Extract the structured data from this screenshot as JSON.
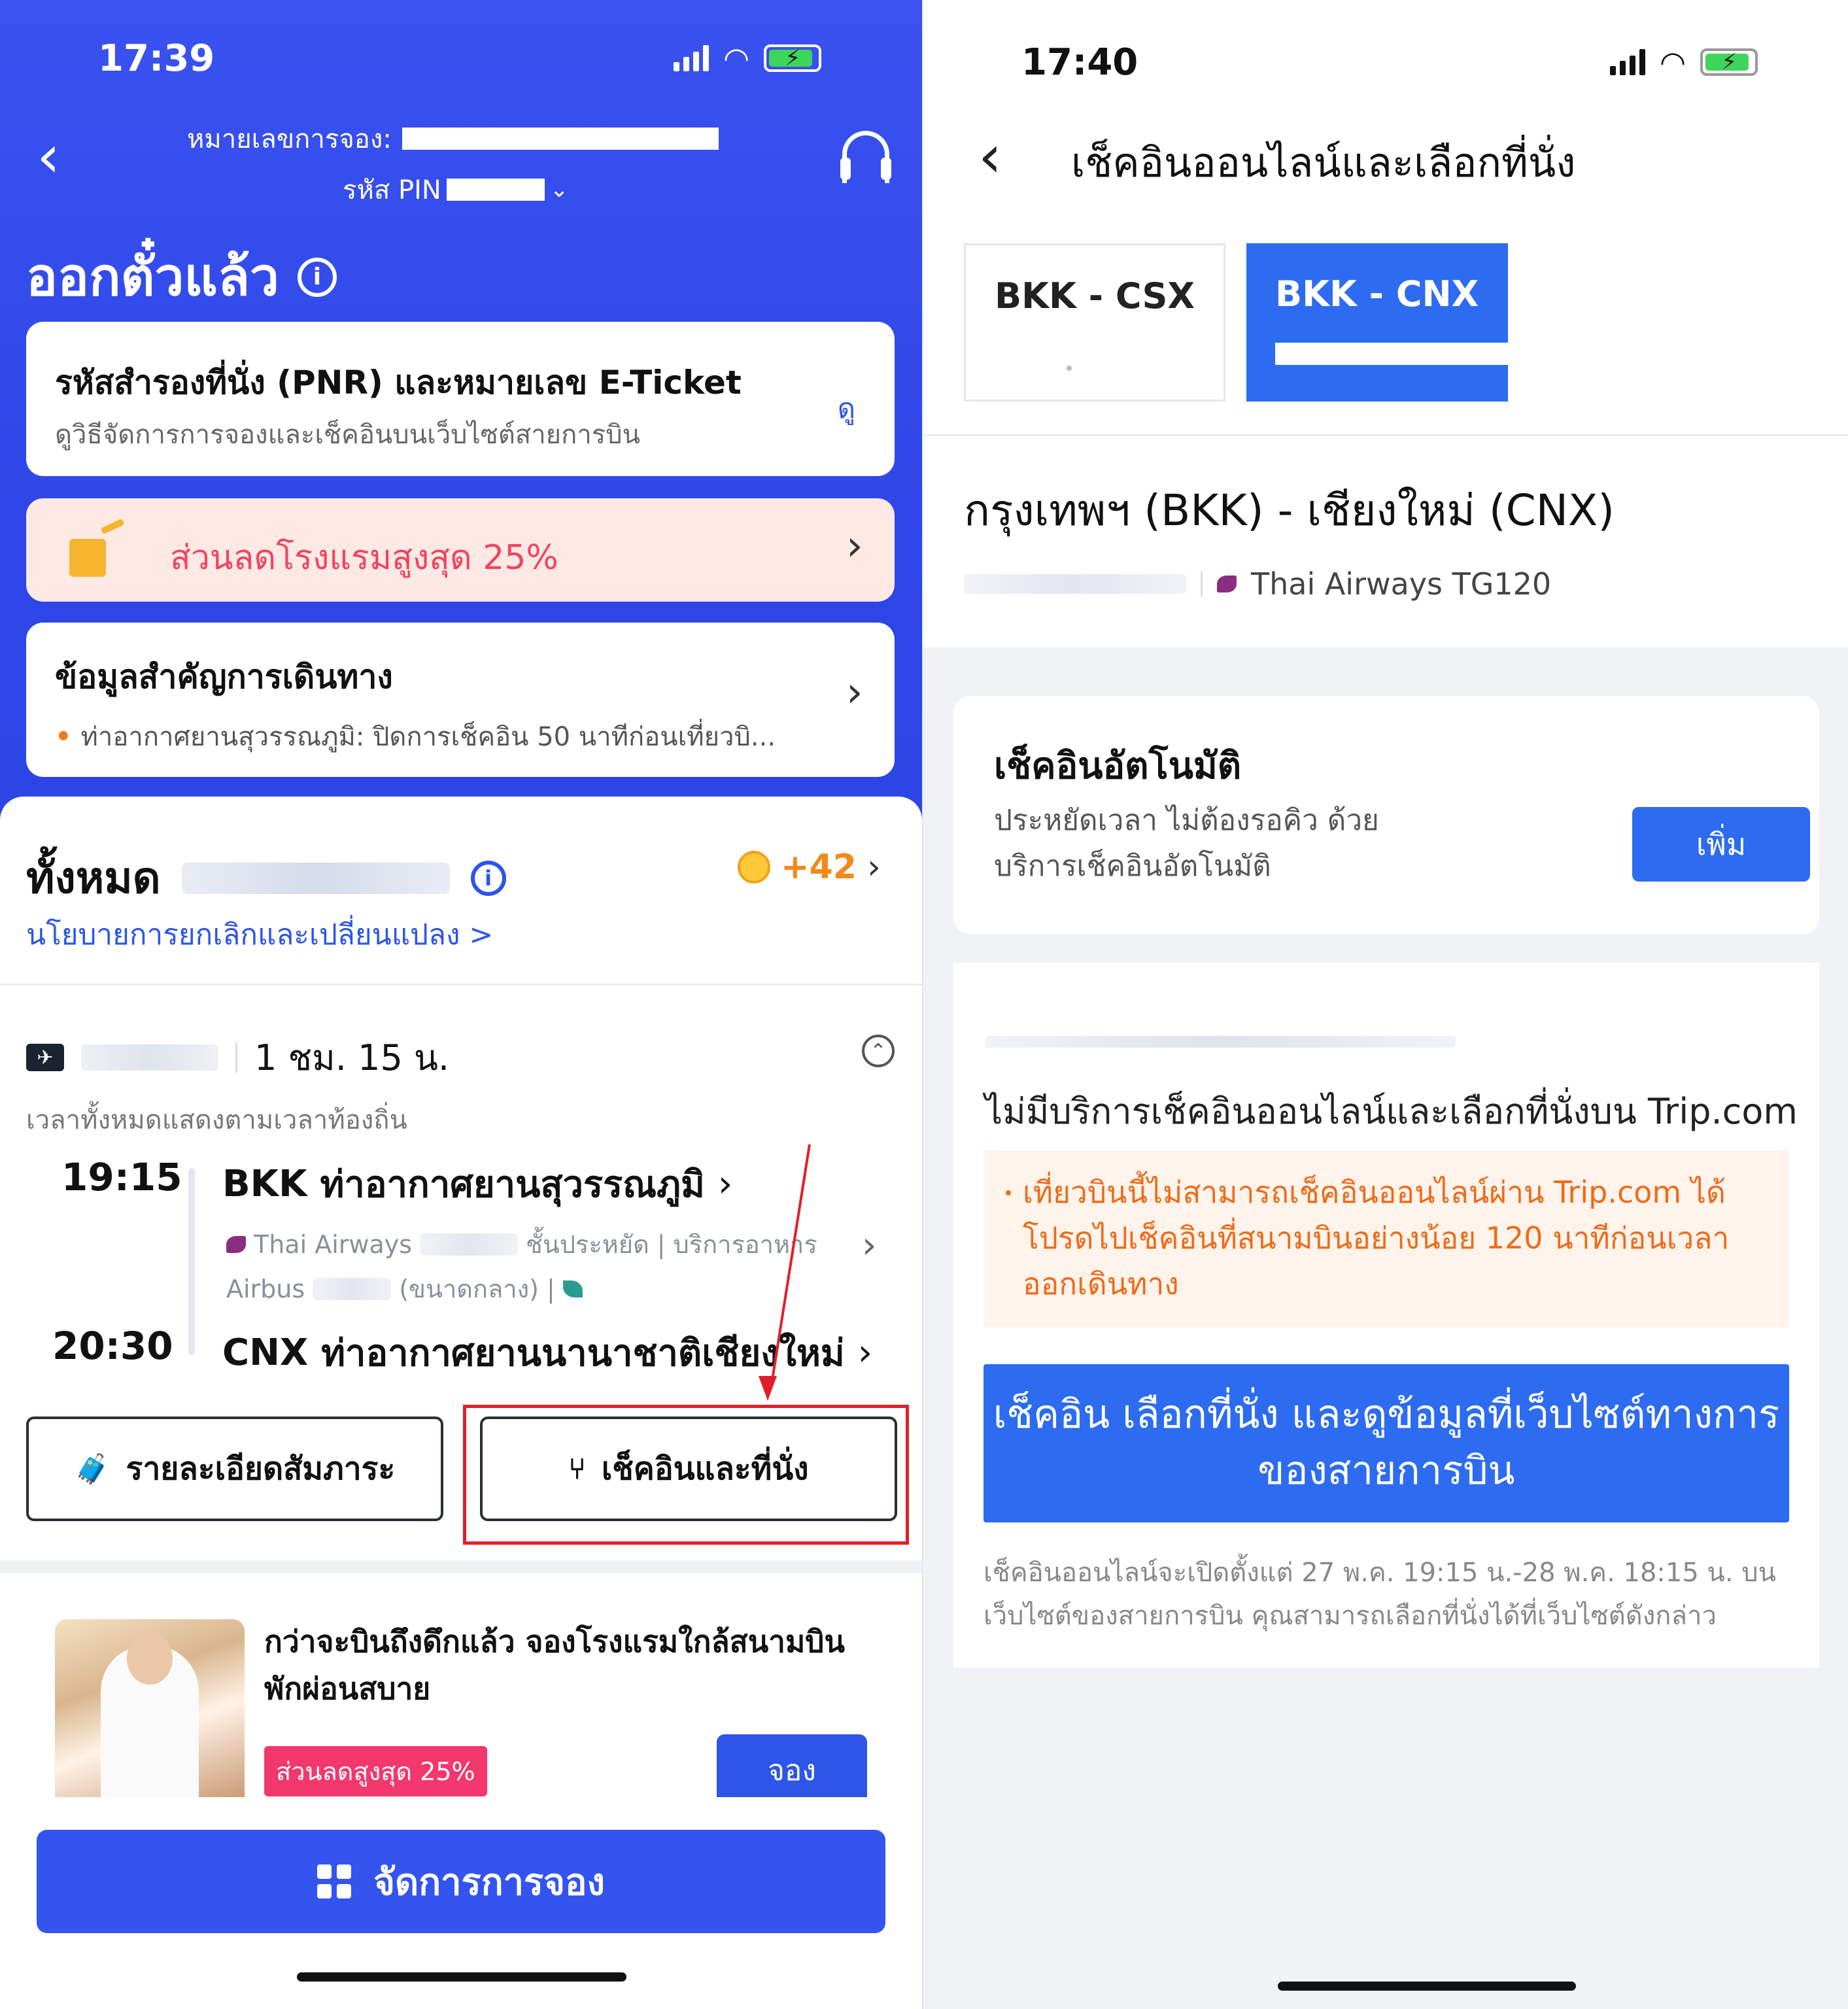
{
  "left": {
    "status": {
      "time": "17:39"
    },
    "header": {
      "booking_label": "หมายเลขการจอง:",
      "pin_label": "รหัส PIN"
    },
    "title": "ออกตั๋วแล้ว",
    "pnr_card": {
      "title": "รหัสสำรองที่นั่ง (PNR) และหมายเลข E-Ticket",
      "subtitle": "ดูวิธีจัดการการจองและเช็คอินบนเว็บไซต์สายการบิน",
      "view_label": "ดู"
    },
    "promo": {
      "text": "ส่วนลดโรงแรมสูงสุด 25%"
    },
    "info_card": {
      "title": "ข้อมูลสำคัญการเดินทาง",
      "item": "ท่าอากาศยานสุวรรณภูมิ: ปิดการเช็คอิน 50 นาทีก่อนเที่ยวบิ..."
    },
    "total": {
      "label": "ทั้งหมด",
      "points": "+42"
    },
    "policy_link": "นโยบายการยกเลิกและเปลี่ยนแปลง >",
    "flight": {
      "duration": "1 ชม. 15 น.",
      "local_note": "เวลาทั้งหมดแสดงตามเวลาท้องถิ่น",
      "dep_time": "19:15",
      "dep_code": "BKK",
      "dep_airport": "ท่าอากาศยานสุวรรณภูมิ",
      "airline": "Thai Airways",
      "cabin": "ชั้นประหยัด",
      "service": "บริการอาหาร",
      "aircraft": "Airbus",
      "aircraft_size": "(ขนาดกลาง)",
      "arr_time": "20:30",
      "arr_code": "CNX",
      "arr_airport": "ท่าอากาศยานนานาชาติเชียงใหม่"
    },
    "buttons": {
      "baggage": "รายละเอียดสัมภาระ",
      "checkin": "เช็คอินและที่นั่ง"
    },
    "hotel_card": {
      "title": "กว่าจะบินถึงดึกแล้ว จองโรงแรมใกล้สนามบิน พักผ่อนสบาย",
      "discount": "ส่วนลดสูงสุด 25%",
      "book": "จอง"
    },
    "manage_button": "จัดการการจอง"
  },
  "right": {
    "status": {
      "time": "17:40"
    },
    "title": "เช็คอินออนไลน์และเลือกที่นั่ง",
    "tabs": [
      {
        "label": "BKK - CSX",
        "selected": false
      },
      {
        "label": "BKK - CNX",
        "selected": true
      }
    ],
    "route": "กรุงเทพฯ (BKK) - เชียงใหม่ (CNX)",
    "flight_info": "Thai Airways TG120",
    "auto_checkin": {
      "title": "เช็คอินอัตโนมัติ",
      "subtitle": "ประหยัดเวลา ไม่ต้องรอคิว ด้วยบริการเช็คอินอัตโนมัติ",
      "add": "เพิ่ม"
    },
    "no_service": {
      "title": "ไม่มีบริการเช็คอินออนไลน์และเลือกที่นั่งบน Trip.com",
      "warning": "เที่ยวบินนี้ไม่สามารถเช็คอินออนไลน์ผ่าน Trip.com ได้ โปรดไปเช็คอินที่สนามบินอย่างน้อย 120 นาทีก่อนเวลาออกเดินทาง",
      "website_button": "เช็คอิน เลือกที่นั่ง และดูข้อมูลที่เว็บไซต์ทางการของสายการบิน",
      "note": "เช็คอินออนไลน์จะเปิดตั้งแต่ 27 พ.ค. 19:15 น.-28 พ.ค. 18:15 น. บนเว็บไซต์ของสายการบิน คุณสามารถเลือกที่นั่งได้ที่เว็บไซต์ดังกล่าว"
    }
  },
  "colors": {
    "header_blue": "#3a52f0",
    "accent_blue": "#2d6cf0",
    "promo_pink": "#ef4560",
    "warning_orange": "#f06a1a",
    "highlight_red": "#e11f2a"
  }
}
